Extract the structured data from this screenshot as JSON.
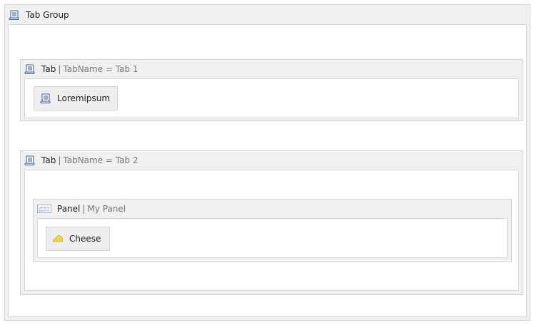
{
  "tab_group": {
    "label": "Tab Group",
    "icon": "scroll-icon"
  },
  "tabs": [
    {
      "type_label": "Tab",
      "separator": "|",
      "detail": "TabName = Tab 1",
      "icon": "scroll-icon",
      "items": [
        {
          "label": "Loremipsum",
          "icon": "scroll-icon"
        }
      ]
    },
    {
      "type_label": "Tab",
      "separator": "|",
      "detail": "TabName = Tab 2",
      "icon": "scroll-icon",
      "panel": {
        "type_label": "Panel",
        "separator": "|",
        "detail": "My Panel",
        "icon": "panel-text-icon",
        "icon_text": [
          "Lorem ip",
          "Ipsum lo"
        ],
        "items": [
          {
            "label": "Cheese",
            "icon": "cheese-icon"
          }
        ]
      }
    }
  ],
  "colors": {
    "frame_bg": "#f0f0f0",
    "body_bg": "#ffffff",
    "border": "#d4d4d4",
    "detail_text": "#777777",
    "icon_blue": "#3b5f9a",
    "cheese_yellow": "#f3dc4a"
  }
}
